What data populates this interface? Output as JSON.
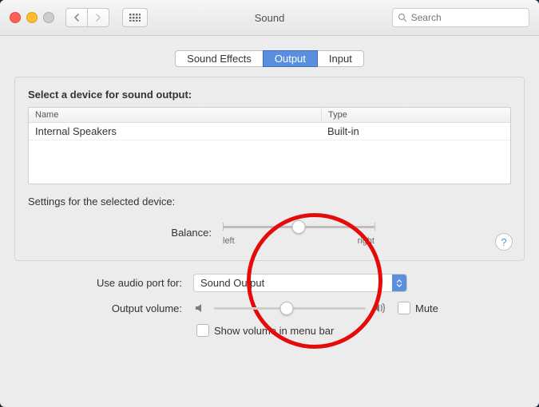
{
  "window": {
    "title": "Sound"
  },
  "search": {
    "placeholder": "Search"
  },
  "tabs": {
    "effects": "Sound Effects",
    "output": "Output",
    "input": "Input",
    "active": "Output"
  },
  "panel": {
    "heading": "Select a device for sound output:",
    "columns": {
      "name": "Name",
      "type": "Type"
    },
    "rows": [
      {
        "name": "Internal Speakers",
        "type": "Built-in"
      }
    ],
    "settings_label": "Settings for the selected device:",
    "balance_label": "Balance:",
    "balance_left": "left",
    "balance_right": "right",
    "balance_value": 50
  },
  "footer": {
    "port_label": "Use audio port for:",
    "port_value": "Sound Output",
    "volume_label": "Output volume:",
    "volume_value": 48,
    "mute_label": "Mute",
    "mute_checked": false,
    "menubar_label": "Show volume in menu bar",
    "menubar_checked": false
  }
}
